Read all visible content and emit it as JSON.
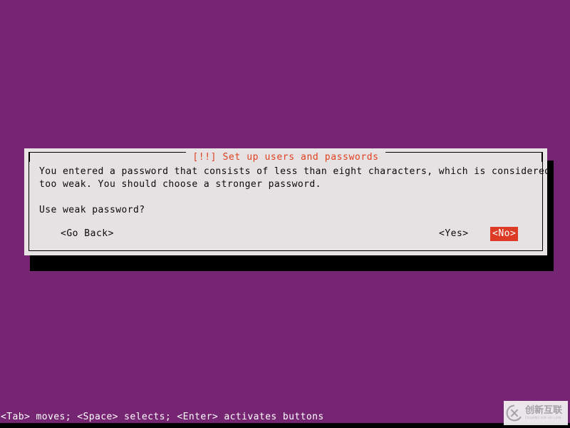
{
  "screen": {
    "background_color": "#762572",
    "terminal_font": "monospace"
  },
  "dialog": {
    "title": "[!!] Set up users and passwords",
    "title_color": "#e0401f",
    "background_color": "#e6e2e4",
    "border_color": "#000000",
    "shadow_color": "#000000",
    "message_lines": [
      "You entered a password that consists of less than eight characters, which is considered",
      "too weak. You should choose a stronger password."
    ],
    "question": "Use weak password?",
    "buttons": [
      {
        "label": "<Go Back>",
        "selected": false
      },
      {
        "label": "<Yes>",
        "selected": false
      },
      {
        "label": "<No>",
        "selected": true,
        "highlight_bg": "#dd3b26",
        "highlight_fg": "#ffffff"
      }
    ]
  },
  "statusbar": {
    "text": "<Tab> moves; <Space> selects; <Enter> activates buttons",
    "background_color": "#762572",
    "text_color": "#ffffff"
  },
  "watermark": {
    "chinese": "创新互联",
    "pinyin": "CHUANG XIN HU LIAN",
    "logo_icon": "cx-circle-logo"
  }
}
